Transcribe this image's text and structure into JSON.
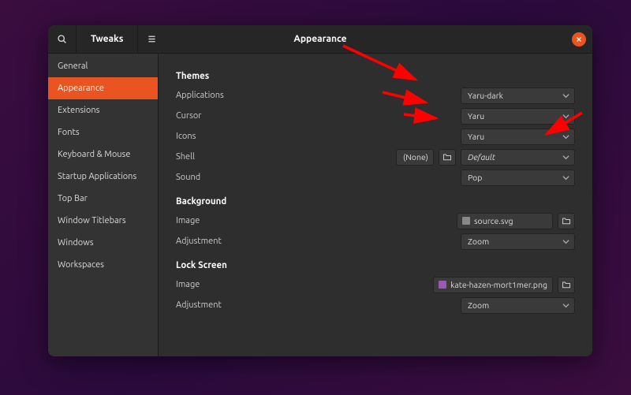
{
  "titlebar": {
    "app_name": "Tweaks",
    "page_title": "Appearance"
  },
  "sidebar": {
    "items": [
      {
        "label": "General"
      },
      {
        "label": "Appearance"
      },
      {
        "label": "Extensions"
      },
      {
        "label": "Fonts"
      },
      {
        "label": "Keyboard & Mouse"
      },
      {
        "label": "Startup Applications"
      },
      {
        "label": "Top Bar"
      },
      {
        "label": "Window Titlebars"
      },
      {
        "label": "Windows"
      },
      {
        "label": "Workspaces"
      }
    ],
    "active_index": 1
  },
  "themes": {
    "heading": "Themes",
    "applications": {
      "label": "Applications",
      "value": "Yaru-dark"
    },
    "cursor": {
      "label": "Cursor",
      "value": "Yaru"
    },
    "icons": {
      "label": "Icons",
      "value": "Yaru"
    },
    "shell": {
      "label": "Shell",
      "none_text": "(None)",
      "value": "Default"
    },
    "sound": {
      "label": "Sound",
      "value": "Pop"
    }
  },
  "background": {
    "heading": "Background",
    "image": {
      "label": "Image",
      "filename": "source.svg"
    },
    "adjustment": {
      "label": "Adjustment",
      "value": "Zoom"
    }
  },
  "lockscreen": {
    "heading": "Lock Screen",
    "image": {
      "label": "Image",
      "filename": "kate-hazen-mort1mer.png"
    },
    "adjustment": {
      "label": "Adjustment",
      "value": "Zoom"
    }
  }
}
